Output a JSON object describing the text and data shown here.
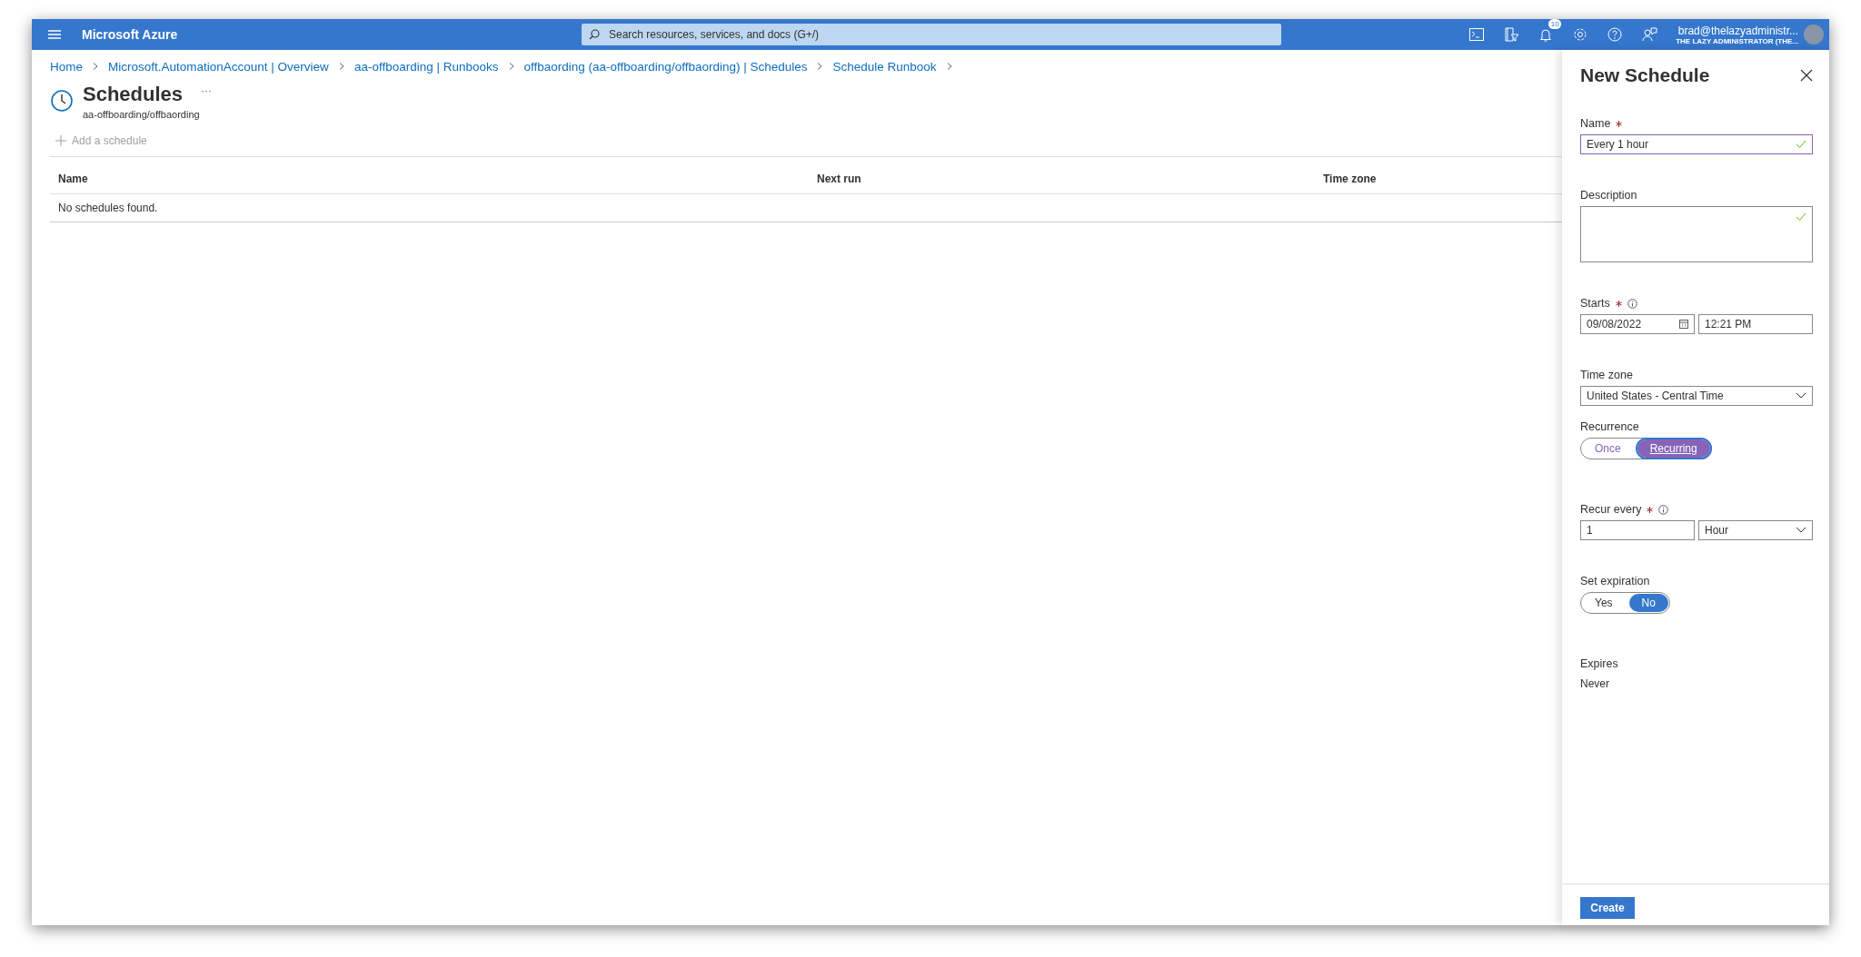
{
  "top_bar": {
    "brand": "Microsoft Azure",
    "search": {
      "placeholder": "Search resources, services, and docs (G+/)"
    },
    "notification_count": "10",
    "account": {
      "name": "brad@thelazyadministr...",
      "tenant": "THE LAZY ADMINISTRATOR (THE..."
    }
  },
  "breadcrumb": [
    "Home",
    "Microsoft.AutomationAccount | Overview",
    "aa-offboarding | Runbooks",
    "offbaording (aa-offboarding/offbaording) | Schedules",
    "Schedule Runbook"
  ],
  "page": {
    "title": "Schedules",
    "more": "···",
    "subtitle": "aa-offboarding/offbaording",
    "toolbar": [
      {
        "label": "Add a schedule",
        "disabled": true
      }
    ],
    "table": {
      "columns": [
        "Name",
        "Next run",
        "Time zone"
      ],
      "empty_message": "No schedules found."
    }
  },
  "panel": {
    "title": "New Schedule",
    "fields": [
      {
        "kind": "text",
        "label": "Name",
        "required": true,
        "info": false,
        "value": "Every 1 hour",
        "valid": true,
        "focused": true
      },
      {
        "kind": "textarea",
        "label": "Description",
        "required": false,
        "info": false,
        "valid": true
      },
      {
        "kind": "datetime",
        "label": "Starts",
        "required": true,
        "info": true,
        "date": "09/08/2022",
        "time": "12:21 PM"
      },
      {
        "kind": "dropdown",
        "label": "Time zone",
        "required": false,
        "info": false,
        "value": "United States - Central Time"
      },
      {
        "kind": "toggle",
        "label": "Recurrence",
        "required": false,
        "info": false,
        "focused": true,
        "options": [
          {
            "label": "Once",
            "selected": false
          },
          {
            "label": "Recurring",
            "selected": true
          }
        ]
      },
      {
        "kind": "number-unit",
        "label": "Recur every",
        "required": true,
        "info": true,
        "value": "1",
        "unit": "Hour"
      },
      {
        "kind": "toggle",
        "label": "Set expiration",
        "required": false,
        "info": false,
        "focused": false,
        "options": [
          {
            "label": "Yes",
            "selected": false
          },
          {
            "label": "No",
            "selected": true
          }
        ]
      },
      {
        "kind": "readonly",
        "label": "Expires",
        "required": false,
        "info": false,
        "value": "Never"
      }
    ],
    "button": "Create"
  }
}
